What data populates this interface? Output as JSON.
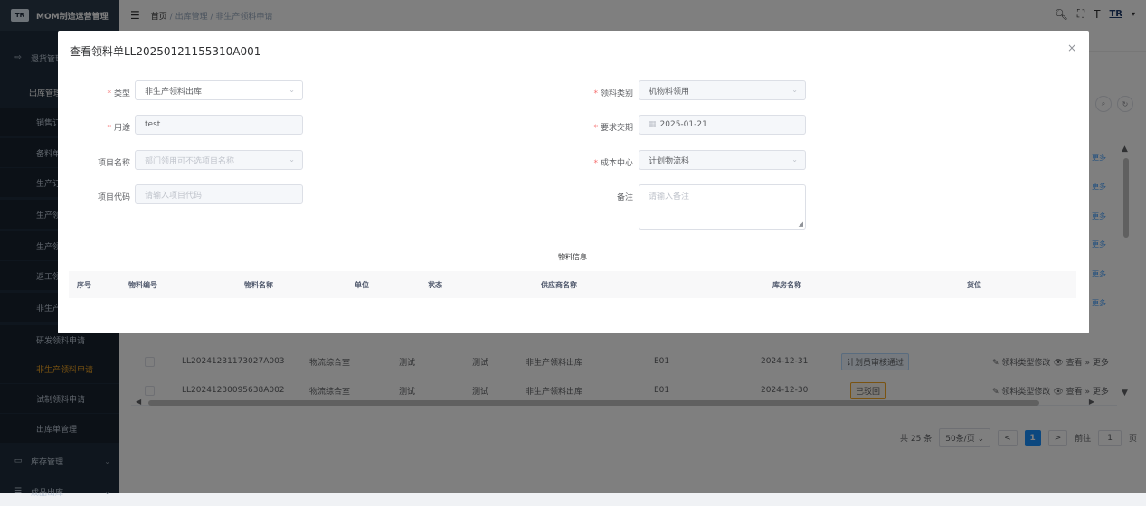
{
  "app": {
    "title": "MOM制造运营管理",
    "logo_text": "TR"
  },
  "header": {
    "breadcrumb": [
      "首页",
      "出库管理",
      "非生产领料申请"
    ],
    "separator": "/"
  },
  "sidebar": {
    "items": [
      {
        "label": "退货管理"
      },
      {
        "label": "出库管理"
      },
      {
        "label": "销售订"
      },
      {
        "label": "备料单"
      },
      {
        "label": "生产订"
      },
      {
        "label": "生产领"
      },
      {
        "label": "生产领"
      },
      {
        "label": "返工领"
      },
      {
        "label": "非生产"
      },
      {
        "label": "研发领料申请"
      },
      {
        "label": "非生产领料申请"
      },
      {
        "label": "试制领料申请"
      },
      {
        "label": "出库单管理"
      },
      {
        "label": "库存管理"
      },
      {
        "label": "成品出库"
      }
    ]
  },
  "background_table": {
    "rows": [
      {
        "code": "LL20241231173027A003",
        "dept": "物流综合室",
        "use": "测试",
        "project": "测试",
        "type": "非生产领料出库",
        "cost": "E01",
        "date": "2024-12-31",
        "status": "计划员审核通过",
        "status_kind": "info"
      },
      {
        "code": "LL20241230095638A002",
        "dept": "物流综合室",
        "use": "测试",
        "project": "测试",
        "type": "非生产领料出库",
        "cost": "E01",
        "date": "2024-12-30",
        "status": "已驳回",
        "status_kind": "warn"
      }
    ],
    "op_edit": "领料类型修改",
    "op_view": "查看",
    "op_more": "更多",
    "side_more": "更多"
  },
  "pagination": {
    "total": "共 25 条",
    "page_size": "50条/页",
    "current": "1",
    "goto_label": "前往",
    "goto_value": "1",
    "page_unit": "页"
  },
  "modal": {
    "title": "查看领料单LL20250121155310A001",
    "fields": {
      "type_label": "类型",
      "type_value": "非生产领料出库",
      "category_label": "领料类别",
      "category_value": "机物料领用",
      "purpose_label": "用途",
      "purpose_value": "test",
      "due_label": "要求交期",
      "due_value": "2025-01-21",
      "project_name_label": "项目名称",
      "project_name_placeholder": "部门领用可不选项目名称",
      "cost_center_label": "成本中心",
      "cost_center_value": "计划物流科",
      "project_code_label": "项目代码",
      "project_code_placeholder": "请输入项目代码",
      "remark_label": "备注",
      "remark_placeholder": "请输入备注"
    },
    "divider": "物料信息",
    "table_headers": [
      "序号",
      "物料编号",
      "物料名称",
      "单位",
      "状态",
      "供应商名称",
      "库房名称",
      "货位"
    ]
  },
  "colors": {
    "sidebar_bg": "#1f2d3d",
    "active_menu": "#f5a623",
    "primary": "#1890ff",
    "required": "#f56c6c"
  }
}
